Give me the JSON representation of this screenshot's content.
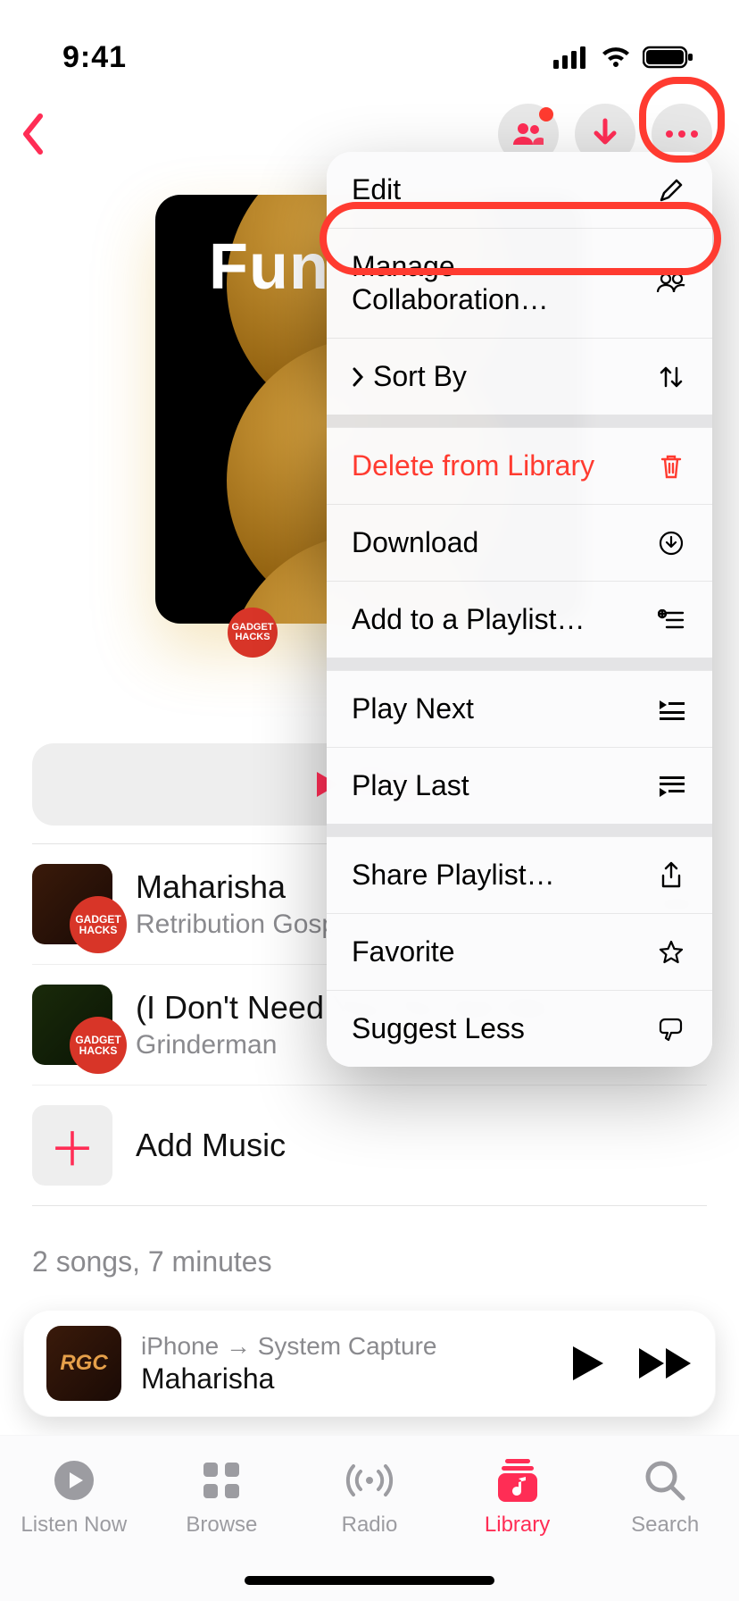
{
  "status": {
    "time": "9:41"
  },
  "playlist": {
    "title": "Fun",
    "play_label": "Play",
    "add_music_label": "Add Music",
    "summary": "2 songs, 7 minutes",
    "watermark": "GADGET HACKS"
  },
  "songs": [
    {
      "title": "Maharisha",
      "artist": "Retribution Gospel Choir"
    },
    {
      "title": "(I Don't Need You To) Set Me Free",
      "artist": "Grinderman"
    }
  ],
  "menu": {
    "edit": "Edit",
    "collaboration": "Manage Collaboration…",
    "sort_by": "Sort By",
    "delete": "Delete from Library",
    "download": "Download",
    "add_playlist": "Add to a Playlist…",
    "play_next": "Play Next",
    "play_last": "Play Last",
    "share": "Share Playlist…",
    "favorite": "Favorite",
    "suggest_less": "Suggest Less"
  },
  "now_playing": {
    "route": "iPhone → System Capture",
    "title": "Maharisha"
  },
  "tabs": {
    "listen_now": "Listen Now",
    "browse": "Browse",
    "radio": "Radio",
    "library": "Library",
    "search": "Search"
  }
}
